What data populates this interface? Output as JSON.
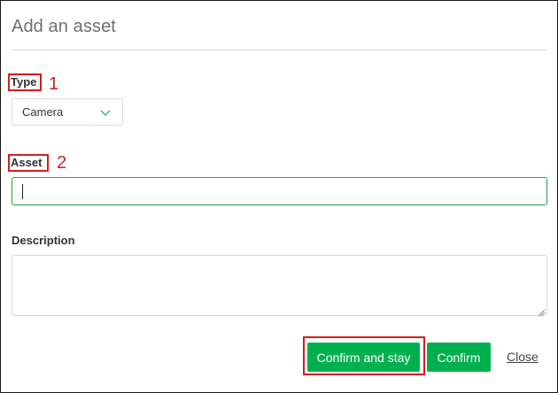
{
  "dialog": {
    "title": "Add an asset"
  },
  "type_field": {
    "label": "Type",
    "annotation": "1",
    "selected_value": "Camera",
    "dropdown_icon": "chevron-down-icon"
  },
  "asset_field": {
    "label": "Asset",
    "annotation": "2",
    "value": "",
    "placeholder": ""
  },
  "description_field": {
    "label": "Description",
    "value": ""
  },
  "actions": {
    "confirm_and_stay": "Confirm and stay",
    "confirm": "Confirm",
    "close": "Close"
  },
  "colors": {
    "primary_button": "#00b04f",
    "annotation_red": "#d21f1f",
    "focus_border": "#22a04a",
    "chevron": "#2bb3a0"
  }
}
